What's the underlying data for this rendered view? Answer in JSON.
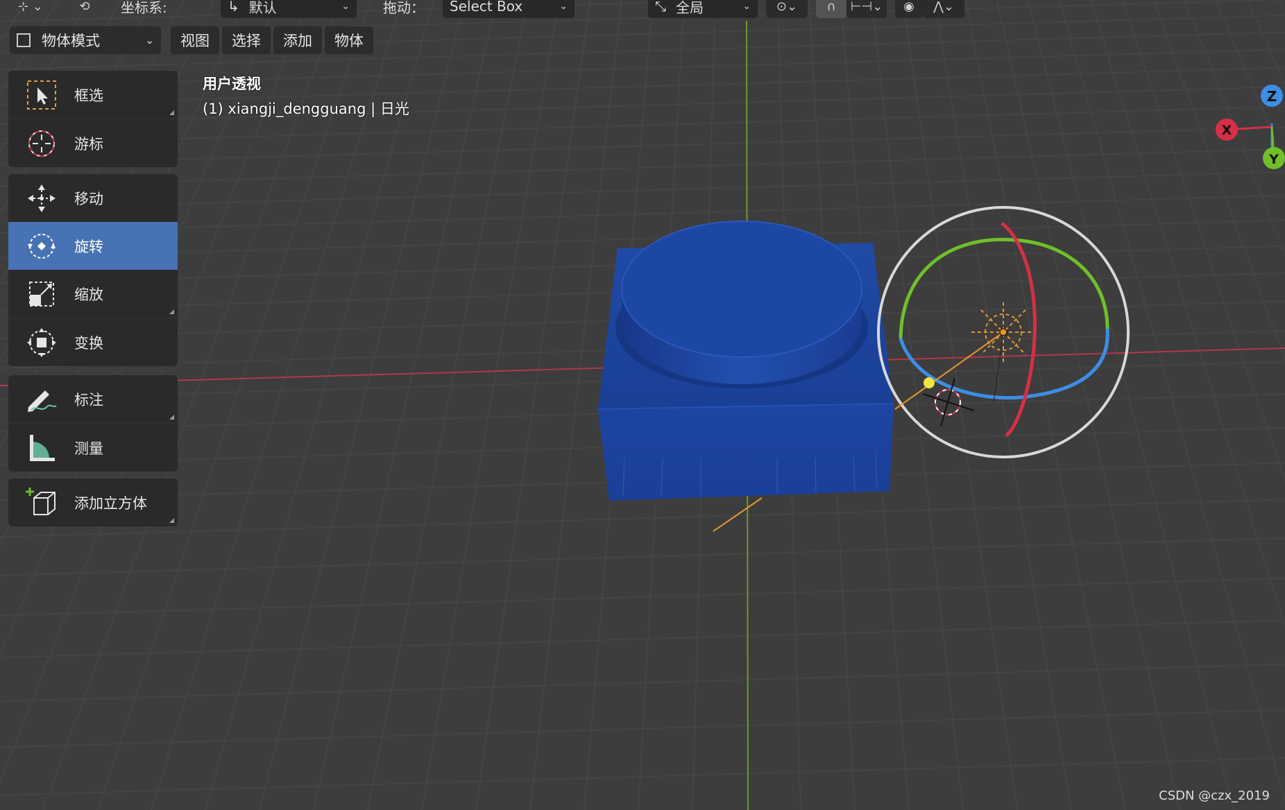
{
  "topbar": {
    "coord_label": "坐标系:",
    "coord_value": "默认",
    "drag_label": "拖动：",
    "drag_value": "Select Box",
    "global_value": "全局"
  },
  "header": {
    "mode": "物体模式",
    "menus": [
      "视图",
      "选择",
      "添加",
      "物体"
    ]
  },
  "tools": [
    {
      "label": "框选",
      "icon": "select-box-icon"
    },
    {
      "label": "游标",
      "icon": "cursor-icon"
    },
    {
      "label": "移动",
      "icon": "move-icon"
    },
    {
      "label": "旋转",
      "icon": "rotate-icon",
      "active": true
    },
    {
      "label": "缩放",
      "icon": "scale-icon"
    },
    {
      "label": "变换",
      "icon": "transform-icon"
    },
    {
      "label": "标注",
      "icon": "annotate-icon"
    },
    {
      "label": "测量",
      "icon": "measure-icon"
    },
    {
      "label": "添加立方体",
      "icon": "add-cube-icon"
    }
  ],
  "viewport": {
    "view_name": "用户透视",
    "object_info": "(1) xiangji_dengguang | 日光"
  },
  "axes": {
    "x": "X",
    "y": "Y",
    "z": "Z"
  },
  "colors": {
    "active_tool": "#4772b3",
    "x_axis": "#d53046",
    "y_axis": "#6fbf2a",
    "z_axis": "#3d8ee6",
    "object": "#1c44a0",
    "background": "#3d3d3d"
  },
  "watermark": "CSDN @czx_2019"
}
